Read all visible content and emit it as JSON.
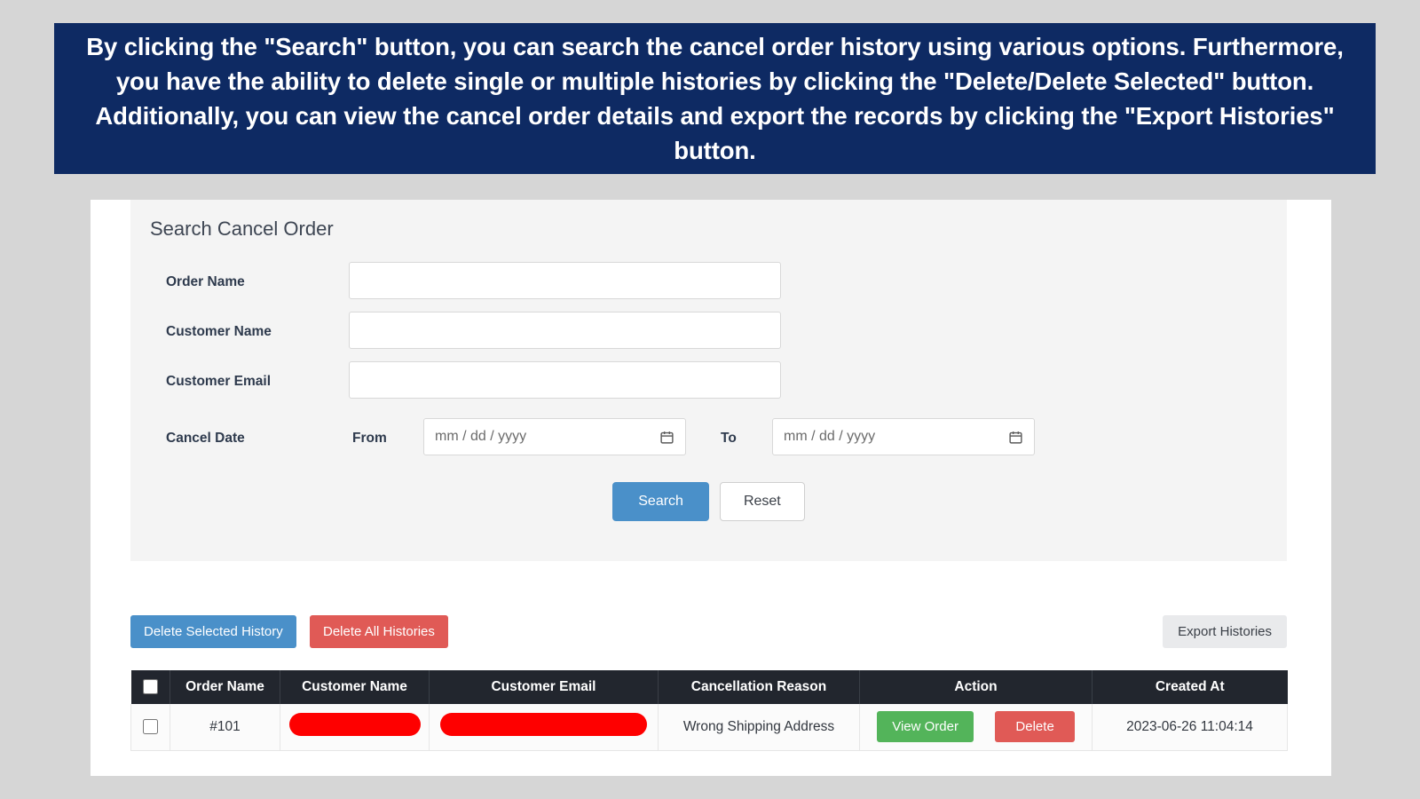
{
  "banner": {
    "text": "By clicking the \"Search\" button, you can search the cancel order history using various options. Furthermore, you have the ability to delete single or multiple histories by clicking the \"Delete/Delete Selected\" button. Additionally, you can view the cancel order details and export the records by clicking the \"Export Histories\" button.",
    "background_color": "#0e2a63",
    "text_color": "#ffffff"
  },
  "search_panel": {
    "title": "Search Cancel Order",
    "fields": [
      {
        "label": "Order Name",
        "value": "",
        "placeholder": ""
      },
      {
        "label": "Customer Name",
        "value": "",
        "placeholder": ""
      },
      {
        "label": "Customer Email",
        "value": "",
        "placeholder": ""
      }
    ],
    "date_filter": {
      "label": "Cancel Date",
      "from_label": "From",
      "to_label": "To",
      "from_placeholder": "mm / dd / yyyy",
      "to_placeholder": "mm / dd / yyyy",
      "from_value": "",
      "to_value": "",
      "calendar_icon": "calendar-icon"
    },
    "buttons": {
      "search": "Search",
      "reset": "Reset",
      "search_color": "#4a90c9"
    }
  },
  "action_bar": {
    "delete_selected": "Delete Selected History",
    "delete_all": "Delete All Histories",
    "export": "Export Histories",
    "delete_selected_color": "#4a90c9",
    "delete_all_color": "#e05a56",
    "export_color": "#e9eaec"
  },
  "table": {
    "header_background": "#22262e",
    "select_all_icon": "checkbox-icon",
    "columns": [
      "",
      "Order Name",
      "Customer Name",
      "Customer Email",
      "Cancellation Reason",
      "Action",
      "Created At"
    ],
    "rows": [
      {
        "selected": false,
        "order_name": "#101",
        "customer_name": "",
        "customer_name_redacted": true,
        "customer_email": "",
        "customer_email_redacted": true,
        "cancellation_reason": "Wrong Shipping Address",
        "view_label": "View Order",
        "delete_label": "Delete",
        "view_color": "#53b45a",
        "delete_color": "#e05a56",
        "created_at": "2023-06-26 11:04:14"
      }
    ]
  }
}
